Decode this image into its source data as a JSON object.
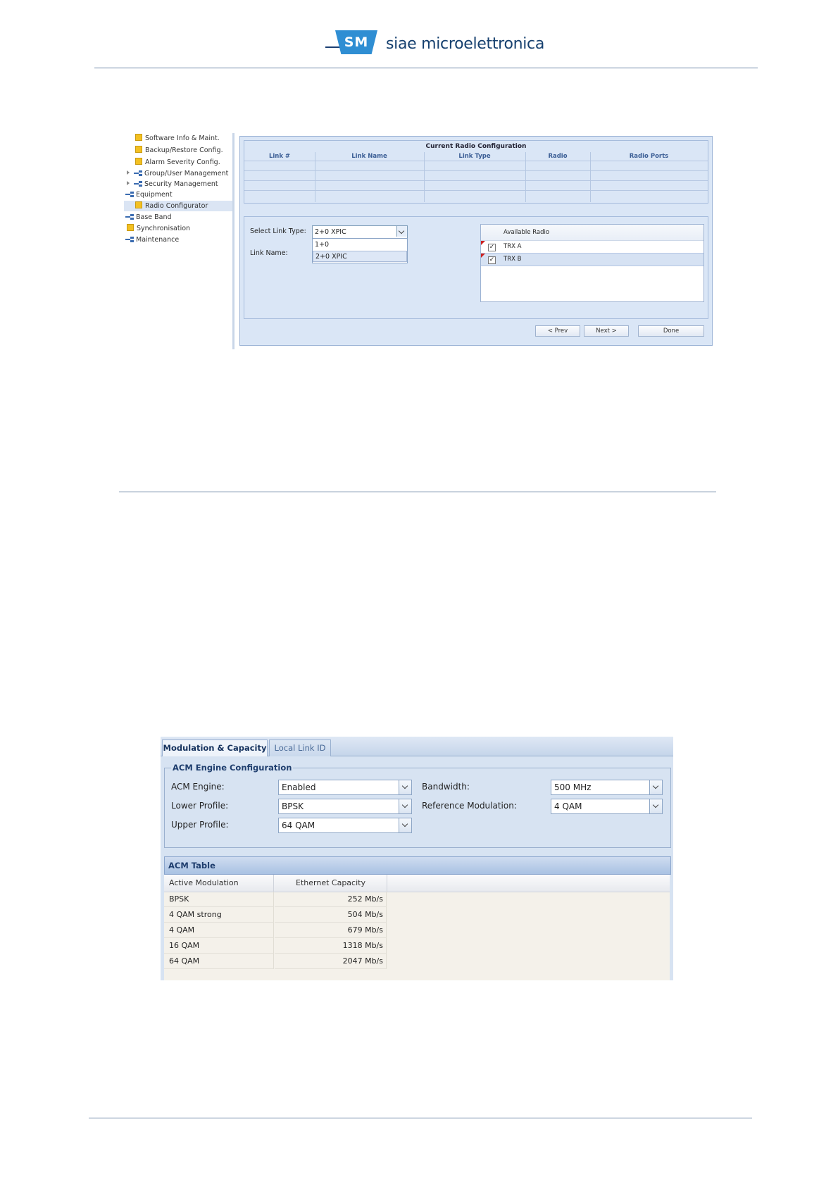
{
  "header": {
    "logo_badge": "SM",
    "logo_text": "siae microelettronica"
  },
  "radio_configurator": {
    "tree": [
      {
        "label": "Software Info & Maint.",
        "icon": "folder"
      },
      {
        "label": "Backup/Restore Config.",
        "icon": "folder"
      },
      {
        "label": "Alarm Severity Config.",
        "icon": "folder"
      },
      {
        "label": "Group/User Management",
        "icon": "network"
      },
      {
        "label": "Security Management",
        "icon": "network"
      },
      {
        "label": "Equipment",
        "icon": "network"
      },
      {
        "label": "Radio Configurator",
        "icon": "folder",
        "selected": true
      },
      {
        "label": "Base Band",
        "icon": "network"
      },
      {
        "label": "Synchronisation",
        "icon": "folder"
      },
      {
        "label": "Maintenance",
        "icon": "network"
      }
    ],
    "config_table": {
      "title": "Current Radio Configuration",
      "columns": [
        "Link #",
        "Link Name",
        "Link Type",
        "Radio",
        "Radio Ports"
      ],
      "rows": [
        [
          "",
          "",
          "",
          "",
          ""
        ],
        [
          "",
          "",
          "",
          "",
          ""
        ],
        [
          "",
          "",
          "",
          "",
          ""
        ],
        [
          "",
          "",
          "",
          "",
          ""
        ]
      ]
    },
    "select_link_type_label": "Select Link Type:",
    "select_link_type_value": "2+0 XPIC",
    "link_type_options": [
      "1+0",
      "2+0 XPIC"
    ],
    "link_name_label": "Link Name:",
    "available_radio": {
      "header": "Available Radio",
      "items": [
        {
          "label": "TRX A",
          "checked": true
        },
        {
          "label": "TRX B",
          "checked": true
        }
      ]
    },
    "buttons": {
      "prev": "< Prev",
      "next": "Next >",
      "done": "Done"
    }
  },
  "acm": {
    "tabs": [
      {
        "label": "Modulation & Capacity",
        "active": true
      },
      {
        "label": "Local Link ID",
        "active": false
      }
    ],
    "engine_legend": "ACM Engine Configuration",
    "fields": {
      "acm_engine_label": "ACM Engine:",
      "acm_engine_value": "Enabled",
      "lower_profile_label": "Lower Profile:",
      "lower_profile_value": "BPSK",
      "upper_profile_label": "Upper Profile:",
      "upper_profile_value": "64 QAM",
      "bandwidth_label": "Bandwidth:",
      "bandwidth_value": "500 MHz",
      "ref_mod_label": "Reference Modulation:",
      "ref_mod_value": "4 QAM"
    },
    "table_title": "ACM Table",
    "table_columns": [
      "Active Modulation",
      "Ethernet Capacity"
    ],
    "table_rows": [
      [
        "BPSK",
        "252 Mb/s"
      ],
      [
        "4 QAM strong",
        "504 Mb/s"
      ],
      [
        "4 QAM",
        "679 Mb/s"
      ],
      [
        "16 QAM",
        "1318 Mb/s"
      ],
      [
        "64 QAM",
        "2047 Mb/s"
      ]
    ]
  }
}
